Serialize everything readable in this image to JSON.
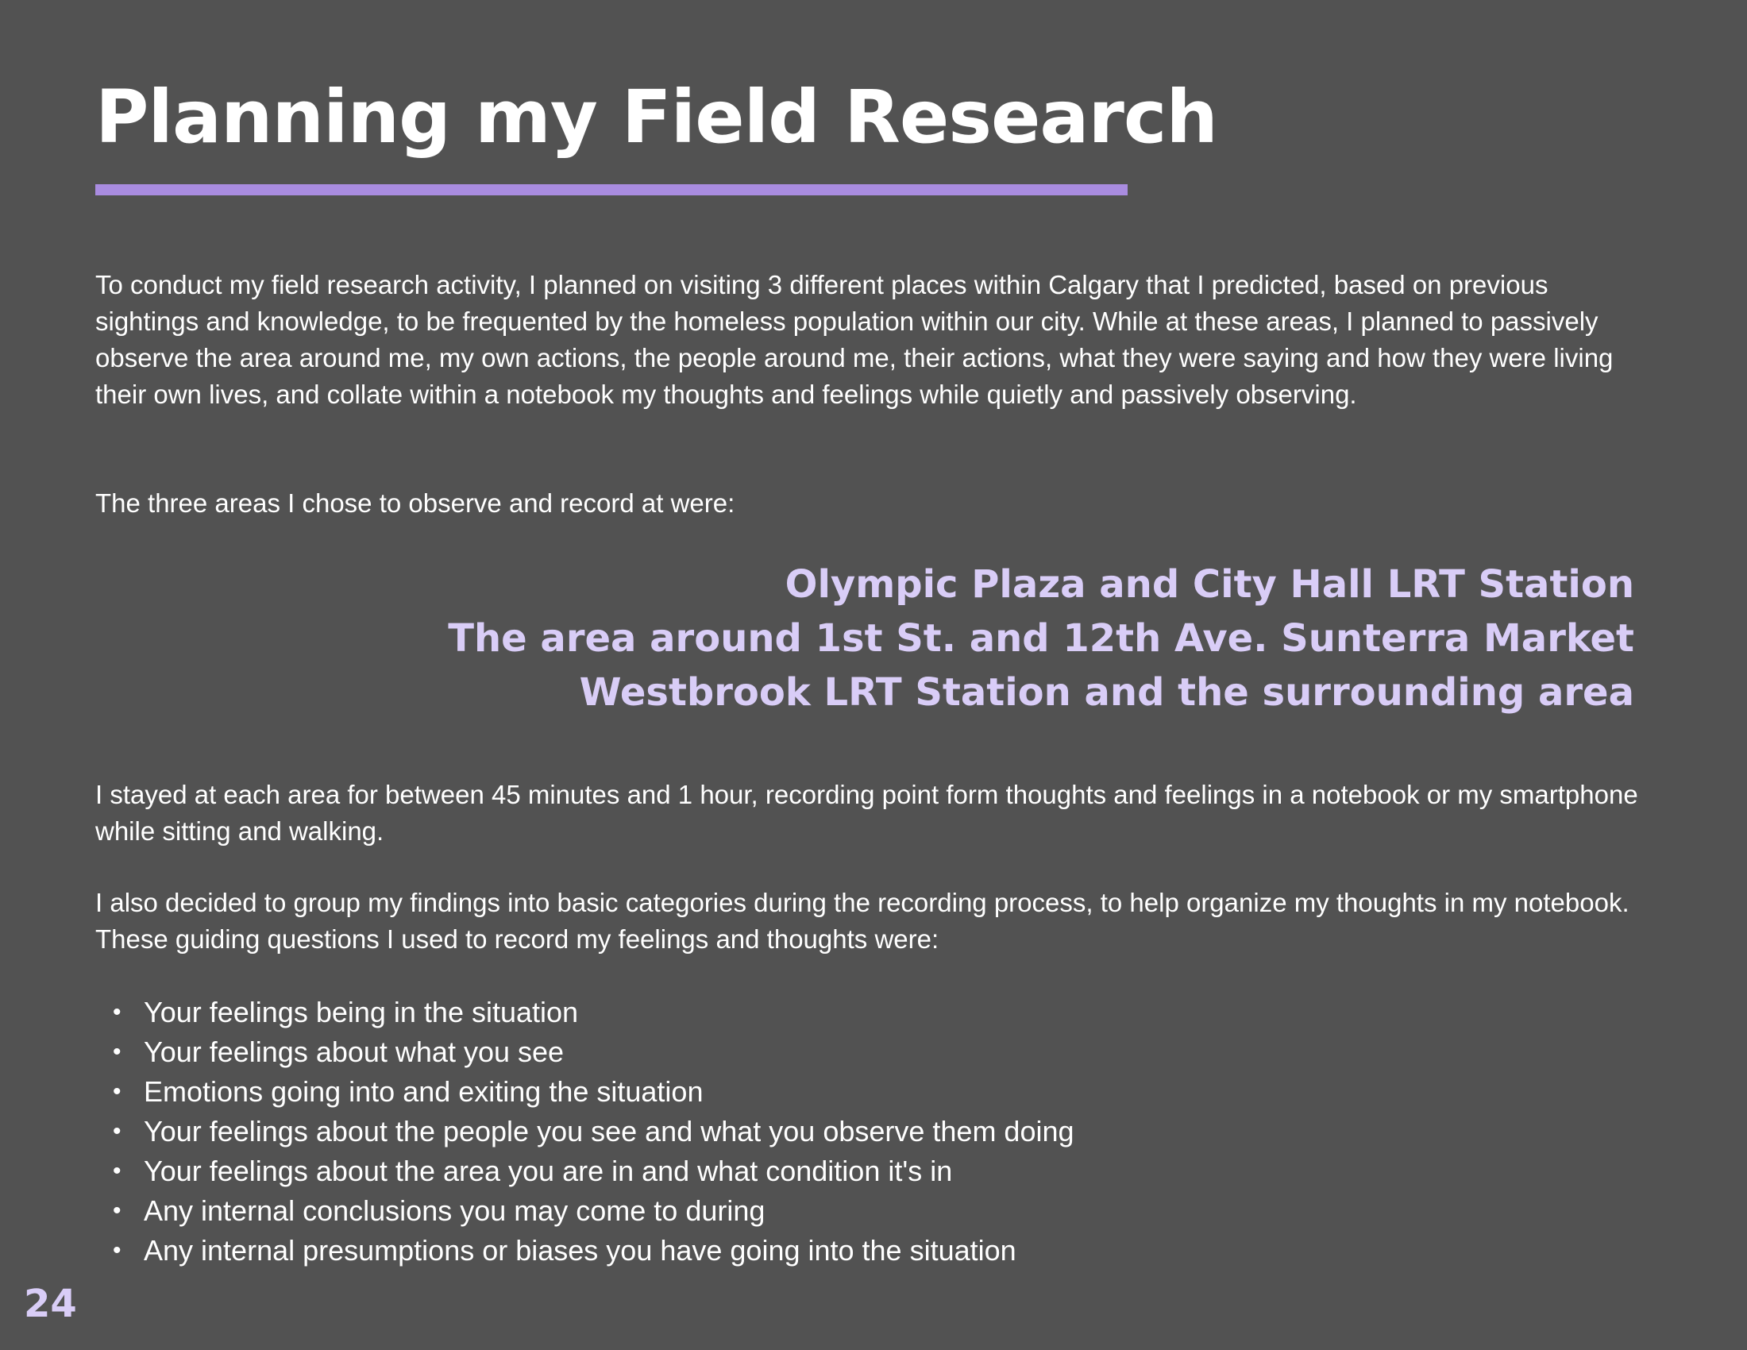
{
  "page": {
    "title": "Planning my Field Research",
    "page_number": "24"
  },
  "colors": {
    "background": "#525252",
    "accent_underline": "#a98ce0",
    "highlight_text": "#d9cdf7",
    "body_text": "#ffffff"
  },
  "paragraphs": {
    "intro": "To conduct my field research activity, I planned on visiting 3 different places within Calgary that I predicted, based on previous sightings and knowledge, to be frequented by the homeless population within our city. While at these areas, I planned to passively observe the area around me, my own actions, the people around me, their actions, what they were saying and how they were living their own lives, and collate within a notebook my thoughts and feelings while quietly and passively observing.",
    "areas_intro": "The three areas I chose to observe and record at were:",
    "duration": "I stayed at each area for between 45 minutes and 1 hour, recording point form thoughts and feelings in a notebook or my smartphone while sitting and walking.",
    "categories": "I also decided to group my findings into basic categories during the recording process, to help organize my thoughts in my notebook. These guiding questions I used to record my feelings and thoughts were:"
  },
  "locations": [
    "Olympic Plaza and City Hall LRT Station",
    "The area around 1st St. and 12th Ave. Sunterra Market",
    "Westbrook LRT Station and the surrounding area"
  ],
  "guiding_questions": [
    "Your feelings being in the situation",
    "Your feelings about what you see",
    "Emotions going into and exiting the situation",
    "Your feelings about the people you see and what you observe them doing",
    "Your feelings about the area you are in and what condition it's in",
    "Any internal conclusions you may come to during",
    "Any internal presumptions or biases you have going into the situation"
  ]
}
